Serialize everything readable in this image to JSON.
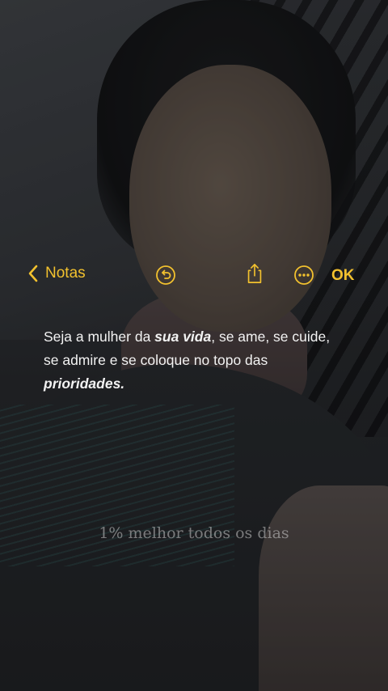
{
  "toolbar": {
    "back_label": "Notas",
    "done_label": "OK",
    "icons": [
      "chevron-left-icon",
      "undo-icon",
      "share-icon",
      "more-icon"
    ],
    "accent_color": "#f2c12e"
  },
  "note": {
    "part1": "Seja a mulher da ",
    "emph1": "sua vida",
    "part2": ", se ame, se cuide, se admire e se coloque no topo das ",
    "emph2": "prioridades.",
    "text_color": "#f2f2f2"
  },
  "caption": "1% melhor todos os dias"
}
